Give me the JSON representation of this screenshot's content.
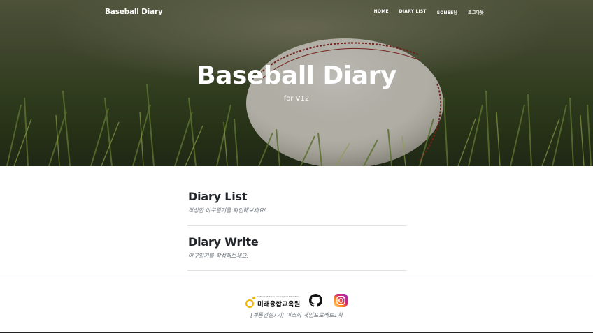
{
  "navbar": {
    "brand": "Baseball Diary",
    "links": [
      "HOME",
      "DIARY LIST",
      "SONEE님",
      "로그아웃"
    ]
  },
  "hero": {
    "title": "Baseball Diary",
    "subtitle": "for V12"
  },
  "posts": [
    {
      "title": "Diary List",
      "subtitle": "작성한 야구일기를 확인해보세요!"
    },
    {
      "title": "Diary Write",
      "subtitle": "야구일기를 작성해보세요!"
    }
  ],
  "footer": {
    "logo_small": "Institute of Future Convergence Education",
    "logo_text": "미래융합교육원",
    "icons": [
      "institute-logo",
      "github-icon",
      "instagram-icon"
    ],
    "text": "[계룡건설7기] 이소희 개인프로젝트1차"
  },
  "colors": {
    "hero_overlay": "#3c4a26",
    "text_dark": "#212529",
    "text_muted": "#6c757d",
    "logo_accent": "#f0b400",
    "instagram_gradient": [
      "#feda75",
      "#d62976",
      "#962fbf"
    ]
  }
}
